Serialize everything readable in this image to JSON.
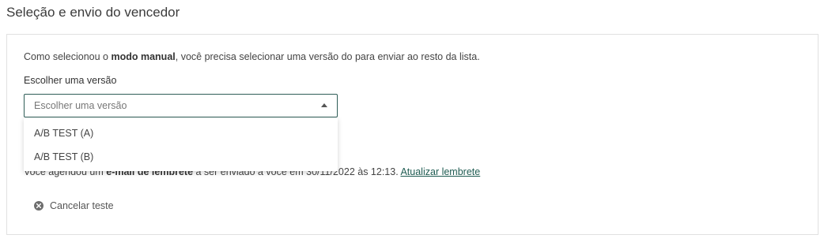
{
  "page": {
    "title": "Seleção e envio do vencedor"
  },
  "intro": {
    "prefix": "Como selecionou o ",
    "emphasis": "modo manual",
    "suffix": ", você precisa selecionar uma versão do para enviar ao resto da lista."
  },
  "version_field": {
    "label": "Escolher uma versão",
    "placeholder": "Escolher uma versão",
    "options": [
      "A/B TEST (A)",
      "A/B TEST (B)"
    ]
  },
  "reminder": {
    "prefix": "Você agendou um ",
    "emphasis": "e-mail de lembrete",
    "middle": " a ser enviado a você em 30/11/2022 às 12:13. ",
    "link": "Atualizar lembrete"
  },
  "cancel": {
    "label": "Cancelar teste",
    "icon": "close-circle-icon"
  },
  "colors": {
    "accent": "#2f5d57",
    "link": "#1f5c52"
  }
}
